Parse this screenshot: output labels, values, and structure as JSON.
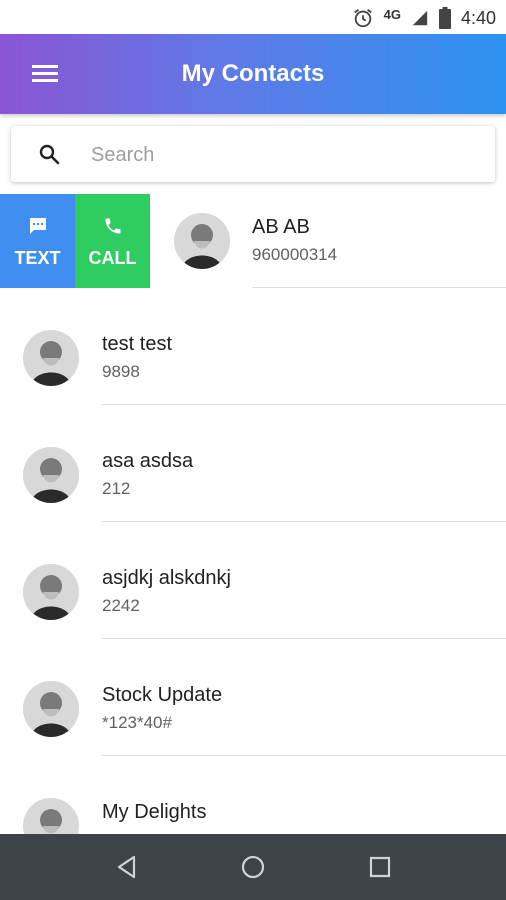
{
  "status_bar": {
    "time": "4:40",
    "network": "4G",
    "icons": [
      "alarm-icon",
      "signal-icon",
      "battery-icon"
    ]
  },
  "app_bar": {
    "title": "My Contacts",
    "menu_icon": "menu-icon",
    "gradient_colors": [
      "#8a55d6",
      "#2d93f0"
    ]
  },
  "search": {
    "placeholder": "Search",
    "value": ""
  },
  "swipe_actions": {
    "text_label": "TEXT",
    "call_label": "CALL",
    "text_color": "#3f8ef0",
    "call_color": "#2ecc61"
  },
  "contacts": [
    {
      "name": "AB AB",
      "number": "960000314"
    },
    {
      "name": "test test",
      "number": "9898"
    },
    {
      "name": "asa asdsa",
      "number": "212"
    },
    {
      "name": "asjdkj alskdnkj",
      "number": "2242"
    },
    {
      "name": "Stock Update",
      "number": "*123*40#"
    },
    {
      "name": "My Delights",
      "number": ""
    }
  ],
  "nav_bar": {
    "color": "#3d4448",
    "buttons": [
      "back-icon",
      "home-icon",
      "recents-icon"
    ]
  }
}
